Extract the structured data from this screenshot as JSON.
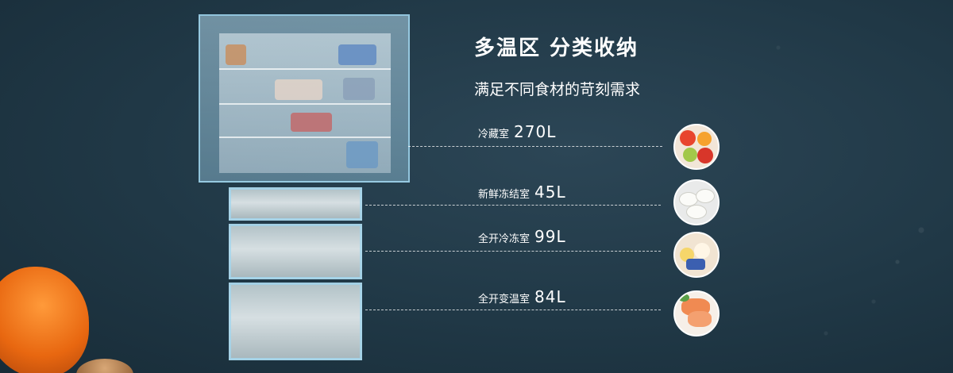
{
  "headline": {
    "title": "多温区 分类收纳",
    "subtitle": "满足不同食材的苛刻需求"
  },
  "zones": [
    {
      "name": "冷藏室",
      "volume": "270L",
      "icon": "fruit-icon"
    },
    {
      "name": "新鲜冻结室",
      "volume": "45L",
      "icon": "dumplings-icon"
    },
    {
      "name": "全开冷冻室",
      "volume": "99L",
      "icon": "ice-cream-icon"
    },
    {
      "name": "全开变温室",
      "volume": "84L",
      "icon": "salmon-icon"
    }
  ],
  "colors": {
    "background": "#203846",
    "frame": "#a0d7f0",
    "text": "#ffffff"
  }
}
